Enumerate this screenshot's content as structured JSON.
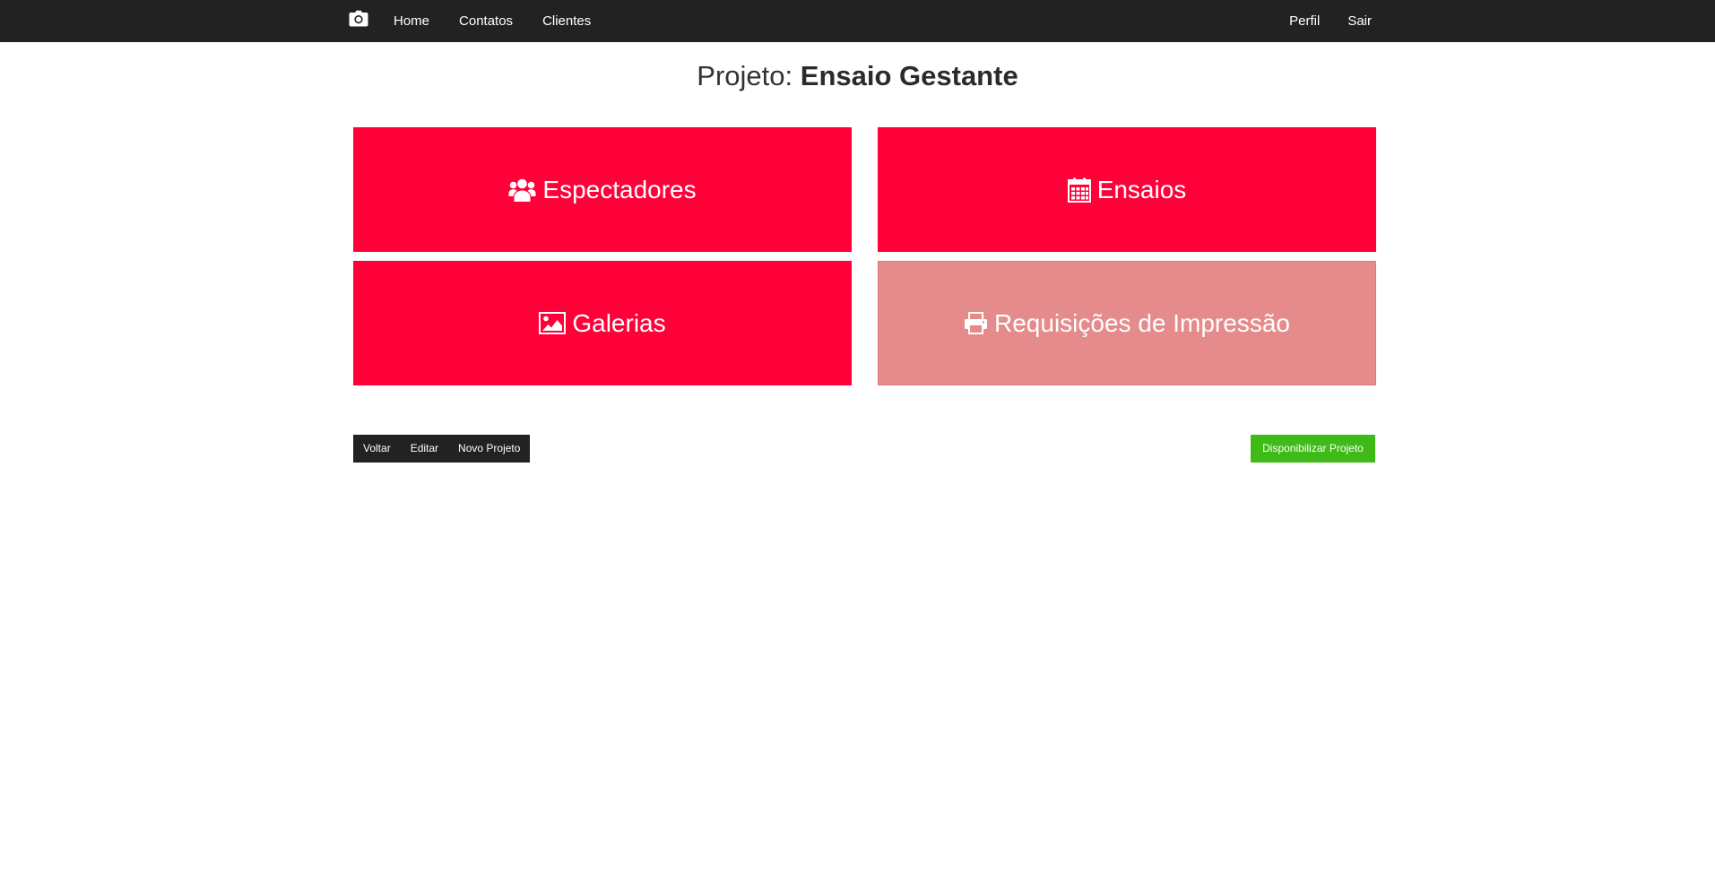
{
  "navbar": {
    "brand_icon": "camera-icon",
    "left_links": [
      "Home",
      "Contatos",
      "Clientes"
    ],
    "right_links": [
      "Perfil",
      "Sair"
    ]
  },
  "title": {
    "prefix": "Projeto:",
    "name": "Ensaio Gestante"
  },
  "tiles": [
    {
      "label": "Espectadores",
      "icon": "users-icon"
    },
    {
      "label": "Ensaios",
      "icon": "calendar-icon"
    },
    {
      "label": "Galerias",
      "icon": "image-icon"
    },
    {
      "label": "Requisições de Impressão",
      "icon": "printer-icon",
      "state": "disabled"
    }
  ],
  "actions": {
    "back_label": "Voltar",
    "edit_label": "Editar",
    "new_label": "Novo Projeto",
    "publish_label": "Disponibilizar Projeto"
  },
  "colors": {
    "navbar": "#222222",
    "tile": "#ff0038",
    "tile_disabled": "#e58b8b",
    "publish": "#3fbb17"
  }
}
